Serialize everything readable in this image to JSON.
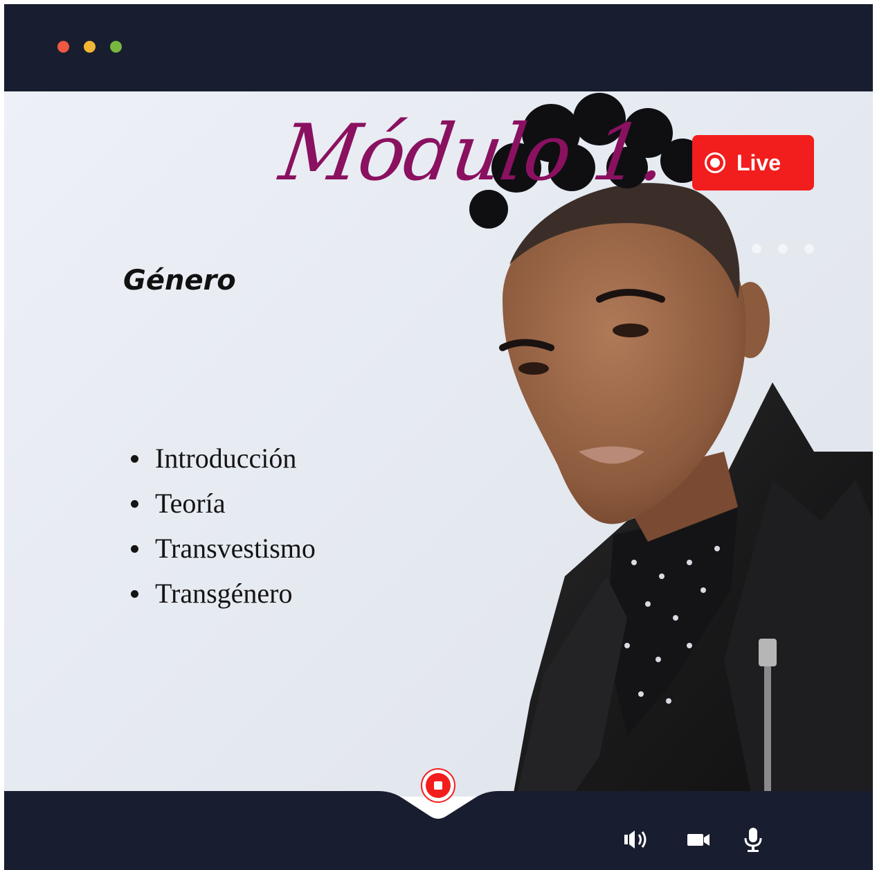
{
  "window": {
    "controls": [
      "close",
      "minimize",
      "maximize"
    ],
    "colors": {
      "close": "#ef5842",
      "minimize": "#f3b634",
      "maximize": "#79b63f",
      "bar": "#181e2f"
    }
  },
  "slide": {
    "title": "Módulo 1.",
    "subtitle": "Género",
    "topics": [
      "Introducción",
      "Teoría",
      "Transvestismo",
      "Transgénero"
    ],
    "title_color": "#8a1160"
  },
  "live_badge": {
    "label": "Live",
    "color": "#f21d1d",
    "icon": "record-dot-icon"
  },
  "toolbar": {
    "record_icon": "stop-record-icon",
    "controls": [
      "speaker-icon",
      "video-camera-icon",
      "microphone-icon"
    ]
  }
}
